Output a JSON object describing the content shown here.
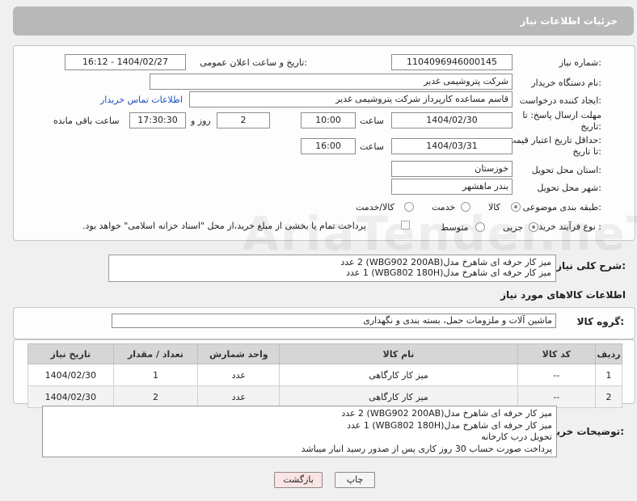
{
  "header": {
    "title": "جزئیات اطلاعات نیاز"
  },
  "form": {
    "need_number_label": "شماره نیاز:",
    "need_number": "1104096946000145",
    "announce_label": "تاریخ و ساعت اعلان عمومی:",
    "announce_value": "1404/02/27 - 16:12",
    "buyer_label": "نام دستگاه خریدار:",
    "buyer_value": "شرکت پتروشیمی غدیر",
    "creator_label": "ایجاد کننده درخواست:",
    "creator_value": "قاسم مساعده کارپرداز شرکت پتروشیمی غدیر",
    "contact_link": "اطلاعات تماس خریدار",
    "deadline_label_1": "مهلت ارسال پاسخ: تا",
    "deadline_label_2": "تاریخ:",
    "deadline_date": "1404/02/30",
    "time_label": "ساعت",
    "deadline_time": "10:00",
    "days_value": "2",
    "days_label": "روز و",
    "remaining_time": "17:30:30",
    "remaining_label": "ساعت باقی مانده",
    "validity_label_1": "حداقل تاریخ اعتبار قیمت:",
    "validity_label_2": "تا تاریخ:",
    "validity_date": "1404/03/31",
    "validity_time": "16:00",
    "province_label": "استان محل تحویل:",
    "province_value": "خوزستان",
    "city_label": "شهر محل تحویل:",
    "city_value": "بندر ماهشهر",
    "category_label": "طبقه بندی موضوعی:",
    "category_options": [
      "کالا",
      "خدمت",
      "کالا/خدمت"
    ],
    "process_label": "نوع فرآیند خرید :",
    "process_options": [
      "جزیی",
      "متوسط"
    ],
    "payment_note": "پرداخت تمام یا بخشی از مبلغ خرید،از محل \"اسناد خزانه اسلامی\" خواهد بود."
  },
  "description": {
    "label": "شرح کلی نیاز:",
    "lines": [
      "میز کار حرفه ای شاهرخ مدل(WBG902 200AB) 2 عدد",
      "میز کار حرفه ای شاهرخ مدل(WBG802 180H) 1 عدد"
    ]
  },
  "goods_info": {
    "title": "اطلاعات کالاهای مورد نیاز",
    "group_label": "گروه کالا:",
    "group_value": "ماشین آلات و ملزومات حمل، بسته بندی و نگهداری"
  },
  "table": {
    "headers": [
      "ردیف",
      "کد کالا",
      "نام کالا",
      "واحد شمارش",
      "تعداد / مقدار",
      "تاریخ نیاز"
    ],
    "rows": [
      [
        "1",
        "--",
        "میز کار کارگاهی",
        "عدد",
        "1",
        "1404/02/30"
      ],
      [
        "2",
        "--",
        "میز کار کارگاهی",
        "عدد",
        "2",
        "1404/02/30"
      ]
    ]
  },
  "buyer_notes": {
    "label": "توضیحات خریدار:",
    "lines": [
      "میز کار حرفه ای شاهرخ مدل(WBG902 200AB) 2 عدد",
      "میز کار حرفه ای شاهرخ مدل(WBG802 180H) 1 عدد",
      "تحویل درب کارخانه",
      "پرداخت صورت حساب 30 روز کاری پس از صدور رسید انبار میباشد"
    ]
  },
  "buttons": {
    "print": "چاپ",
    "back": "بازگشت"
  },
  "colors": {
    "header": "#b8b8b8",
    "link": "#1a4fbf",
    "back_button": "#fbe4e4"
  }
}
